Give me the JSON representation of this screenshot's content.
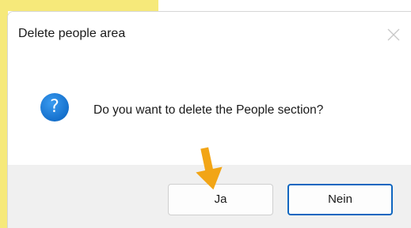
{
  "dialog": {
    "title": "Delete people area",
    "message": "Do you want to delete the People section?",
    "icon": "question-icon",
    "close_icon": "close-icon"
  },
  "buttons": {
    "yes_label": "Ja",
    "no_label": "Nein"
  },
  "annotation": {
    "icon": "arrow-down-icon",
    "color": "#f2a516"
  },
  "colors": {
    "accent": "#0f66c0",
    "icon_blue": "#1570cc",
    "footer_bg": "#f0f0f0",
    "background_yellow": "#f6e97a"
  }
}
